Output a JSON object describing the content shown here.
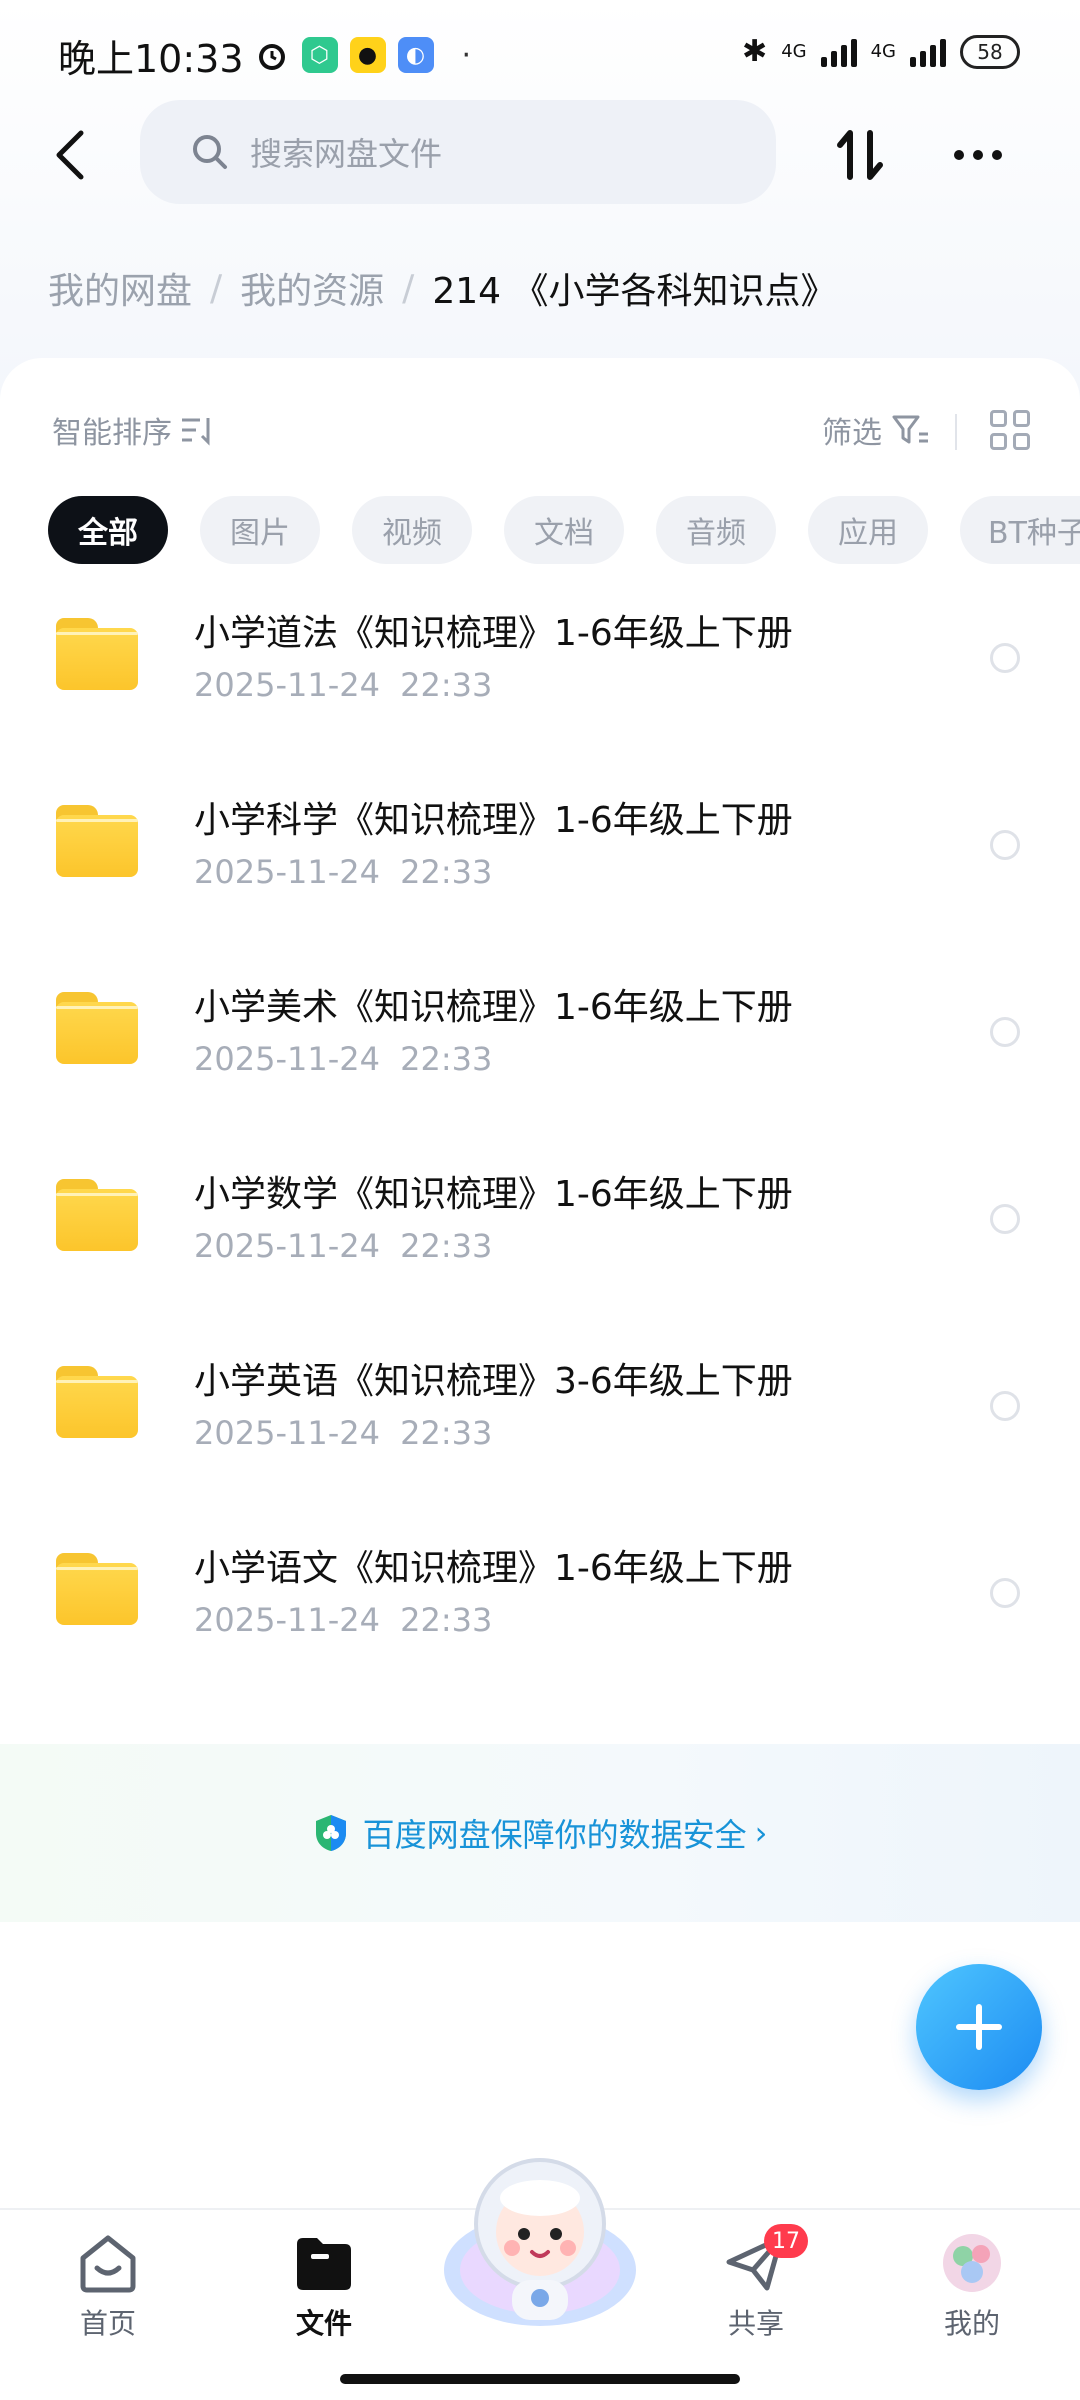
{
  "status_bar": {
    "time": "晚上10:33",
    "network_1": "4G",
    "network_2": "4G",
    "battery": "58"
  },
  "header": {
    "search_placeholder": "搜索网盘文件"
  },
  "breadcrumb": {
    "items": [
      "我的网盘",
      "我的资源"
    ],
    "current": "214 《小学各科知识点》"
  },
  "toolbar": {
    "sort_label": "智能排序",
    "filter_label": "筛选"
  },
  "filters": [
    {
      "label": "全部",
      "active": true
    },
    {
      "label": "图片",
      "active": false
    },
    {
      "label": "视频",
      "active": false
    },
    {
      "label": "文档",
      "active": false
    },
    {
      "label": "音频",
      "active": false
    },
    {
      "label": "应用",
      "active": false
    },
    {
      "label": "BT种子",
      "active": false
    }
  ],
  "files": [
    {
      "name": "小学道法《知识梳理》1-6年级上下册",
      "date": "2025-11-24 22:33"
    },
    {
      "name": "小学科学《知识梳理》1-6年级上下册",
      "date": "2025-11-24 22:33"
    },
    {
      "name": "小学美术《知识梳理》1-6年级上下册",
      "date": "2025-11-24 22:33"
    },
    {
      "name": "小学数学《知识梳理》1-6年级上下册",
      "date": "2025-11-24 22:33"
    },
    {
      "name": "小学英语《知识梳理》3-6年级上下册",
      "date": "2025-11-24 22:33"
    },
    {
      "name": "小学语文《知识梳理》1-6年级上下册",
      "date": "2025-11-24 22:33"
    }
  ],
  "security_banner": {
    "text": "百度网盘保障你的数据安全"
  },
  "bottom_nav": {
    "home": "首页",
    "files": "文件",
    "share": "共享",
    "share_badge": "17",
    "mine": "我的"
  },
  "colors": {
    "accent": "#1c8bf2",
    "folder": "#fcc52b",
    "badge": "#ff3b4d",
    "active_chip": "#0d1117"
  }
}
